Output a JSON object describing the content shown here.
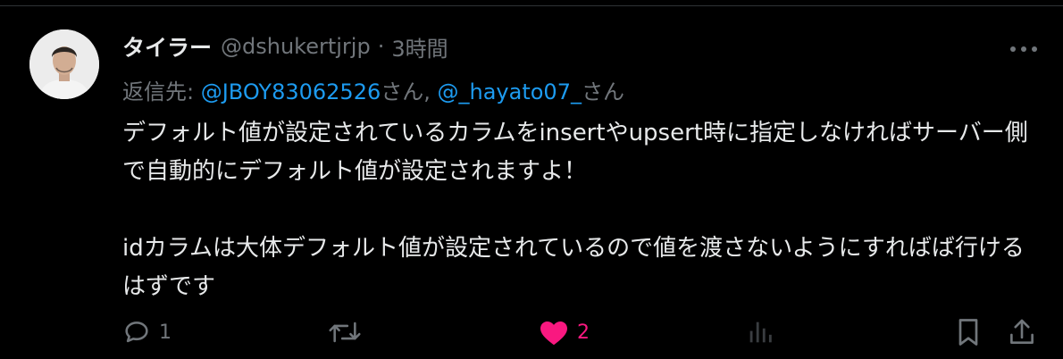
{
  "tweet": {
    "display_name": "タイラー",
    "handle": "@dshukertjrjp",
    "separator": "·",
    "time": "3時間",
    "replying_label": "返信先: ",
    "replying_to": [
      {
        "handle": "@JBOY83062526",
        "suffix": "さん, "
      },
      {
        "handle": "@_hayato07_",
        "suffix": "さん"
      }
    ],
    "paragraphs": [
      "デフォルト値が設定されているカラムをinsertやupsert時に指定しなければサーバー側で自動的にデフォルト値が設定されますよ！",
      "idカラムは大体デフォルト値が設定されているので値を渡さないようにすればば行けるはずです"
    ]
  },
  "actions": {
    "reply_count": "1",
    "retweet_count": "",
    "like_count": "2",
    "like_active": true
  },
  "icons": {
    "more": "more-horizontal-icon",
    "reply": "reply-bubble-icon",
    "retweet": "retweet-icon",
    "like": "heart-filled-icon",
    "analytics": "bar-chart-icon",
    "bookmark": "bookmark-icon",
    "share": "share-upload-icon"
  },
  "colors": {
    "background": "#000000",
    "text": "#e7e9ea",
    "muted": "#71767b",
    "link": "#1d9bf0",
    "like": "#f91880",
    "divider": "#2f3336"
  }
}
